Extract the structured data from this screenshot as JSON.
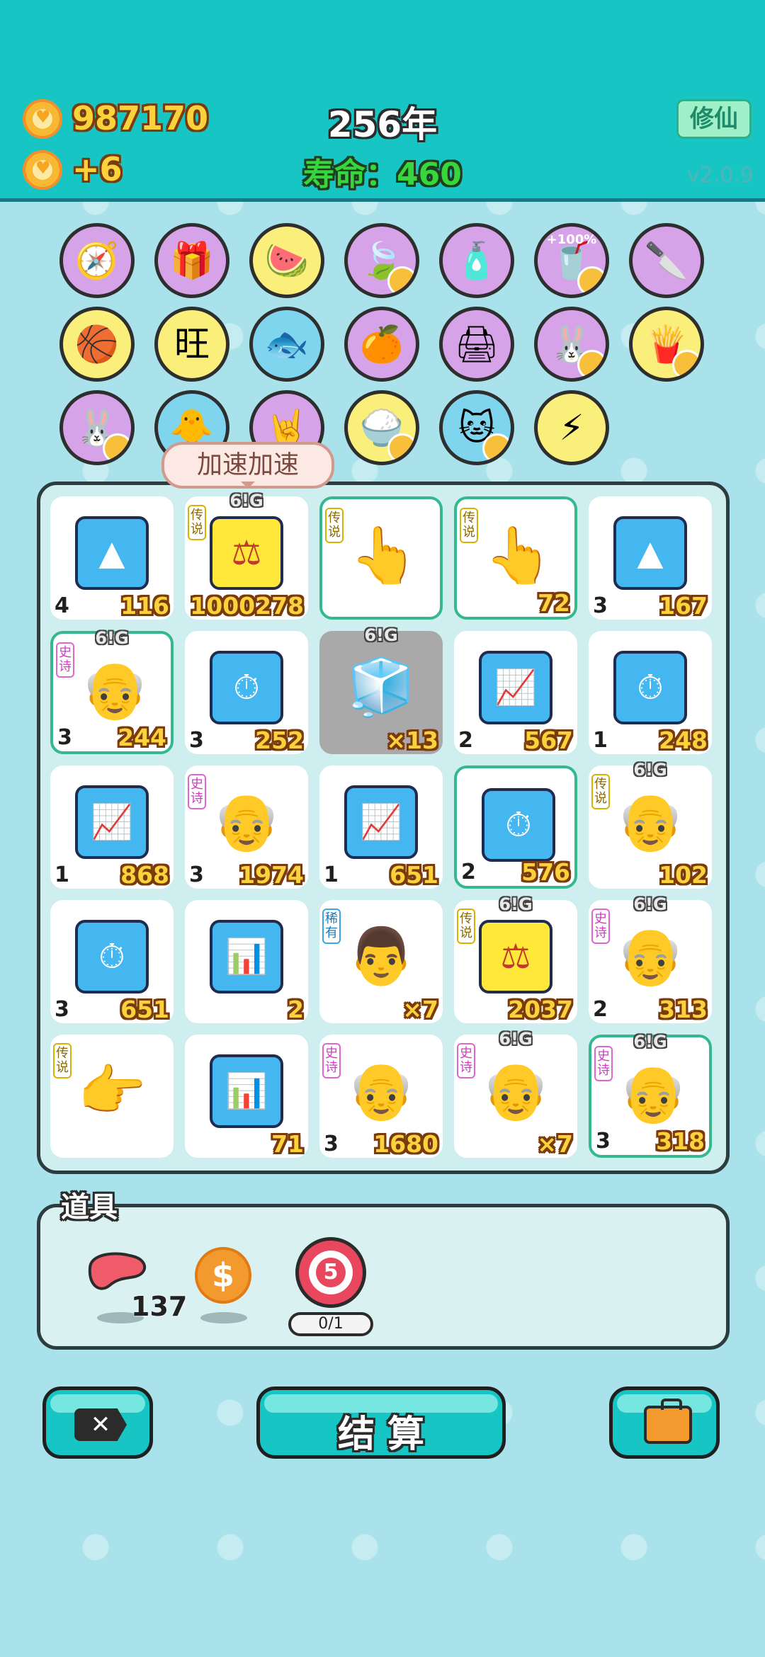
{
  "header": {
    "coins": "987170",
    "income": "+6",
    "year": "256年",
    "life": "寿命：460",
    "xiuxian_label": "修仙",
    "version": "v2.0.9"
  },
  "items": [
    {
      "name": "compass",
      "glyph": "🧭"
    },
    {
      "name": "pink-box",
      "glyph": "🎁"
    },
    {
      "name": "fruit-bowl",
      "glyph": "🍉"
    },
    {
      "name": "leaf",
      "glyph": "🍃"
    },
    {
      "name": "pump-bottle",
      "glyph": "🧴"
    },
    {
      "name": "cup-noodle",
      "glyph": "🥤",
      "label": "+100%"
    },
    {
      "name": "cleaver",
      "glyph": "🔪"
    },
    {
      "name": "basketballs",
      "glyph": "🏀"
    },
    {
      "name": "wang-characters",
      "glyph": "旺"
    },
    {
      "name": "fish-bowl",
      "glyph": "🐟"
    },
    {
      "name": "eyepatch-fruit",
      "glyph": "🍊"
    },
    {
      "name": "printer",
      "glyph": "🖨"
    },
    {
      "name": "bunny",
      "glyph": "🐰"
    },
    {
      "name": "fries",
      "glyph": "🍟"
    },
    {
      "name": "bunny-2",
      "glyph": "🐰"
    },
    {
      "name": "chick",
      "glyph": "🐥"
    },
    {
      "name": "rock-hand",
      "glyph": "🤘"
    },
    {
      "name": "rice-bowl",
      "glyph": "🍚"
    },
    {
      "name": "cat",
      "glyph": "🐱"
    },
    {
      "name": "lightning",
      "glyph": "⚡"
    }
  ],
  "tooltip": "加速加速",
  "tags": {
    "legend": "传说",
    "epic": "史诗",
    "rare": "稀有"
  },
  "sixg": "6!G",
  "board": [
    {
      "art": "gold-bars",
      "glyph": "▲",
      "level": "4",
      "count": "116"
    },
    {
      "art": "scale-crown",
      "glyph": "⚖",
      "tag": "legend",
      "sixg": true,
      "level": "",
      "count": "1000278"
    },
    {
      "art": "pointing-hand",
      "glyph": "👆",
      "tag": "legend",
      "hl": true,
      "level": "",
      "count": ""
    },
    {
      "art": "pointing-hand",
      "glyph": "👆",
      "tag": "legend",
      "hl": true,
      "level": "",
      "count": "72"
    },
    {
      "art": "gold-bars",
      "glyph": "▲",
      "level": "3",
      "count": "167"
    },
    {
      "art": "old-man",
      "glyph": "👴",
      "tag": "epic",
      "sixg": true,
      "hl": true,
      "level": "3",
      "count": "244"
    },
    {
      "art": "stopwatch",
      "glyph": "⏱",
      "level": "3",
      "count": "252"
    },
    {
      "art": "fridge",
      "glyph": "🧊",
      "sixg": true,
      "gray": true,
      "level": "",
      "count": "×13"
    },
    {
      "art": "trend-line",
      "glyph": "📈",
      "level": "2",
      "count": "567"
    },
    {
      "art": "stopwatch",
      "glyph": "⏱",
      "level": "1",
      "count": "248"
    },
    {
      "art": "trend-line",
      "glyph": "📈",
      "level": "1",
      "count": "868"
    },
    {
      "art": "old-man-crown",
      "glyph": "👴",
      "tag": "epic",
      "level": "3",
      "count": "1974"
    },
    {
      "art": "trend-line",
      "glyph": "📈",
      "level": "1",
      "count": "651"
    },
    {
      "art": "stopwatch",
      "glyph": "⏱",
      "hl": true,
      "level": "2",
      "count": "576"
    },
    {
      "art": "bald-man-glasses",
      "glyph": "👴",
      "tag": "legend",
      "sixg": true,
      "level": "",
      "count": "102"
    },
    {
      "art": "stopwatch",
      "glyph": "⏱",
      "level": "3",
      "count": "651"
    },
    {
      "art": "bar-chart",
      "glyph": "📊",
      "level": "",
      "count": "2"
    },
    {
      "art": "bald-man",
      "glyph": "👨",
      "tag": "rare",
      "level": "",
      "count": "×7"
    },
    {
      "art": "scale",
      "glyph": "⚖",
      "tag": "legend",
      "sixg": true,
      "level": "",
      "count": "2037"
    },
    {
      "art": "old-man",
      "glyph": "👴",
      "tag": "epic",
      "sixg": true,
      "level": "2",
      "count": "313"
    },
    {
      "art": "pointing-hand-side",
      "glyph": "👉",
      "tag": "legend",
      "level": "",
      "count": ""
    },
    {
      "art": "bar-chart",
      "glyph": "📊",
      "level": "",
      "count": "71"
    },
    {
      "art": "old-man",
      "glyph": "👴",
      "tag": "epic",
      "level": "3",
      "count": "1680"
    },
    {
      "art": "bald-old-man",
      "glyph": "👴",
      "tag": "epic",
      "sixg": true,
      "level": "",
      "count": "×7"
    },
    {
      "art": "old-man",
      "glyph": "👴",
      "tag": "epic",
      "sixg": true,
      "hl": true,
      "level": "3",
      "count": "318"
    }
  ],
  "props": {
    "title": "道具",
    "liver_count": "137",
    "target_number": "5",
    "target_progress": "0/1"
  },
  "bottom": {
    "settle_label": "结 算"
  }
}
